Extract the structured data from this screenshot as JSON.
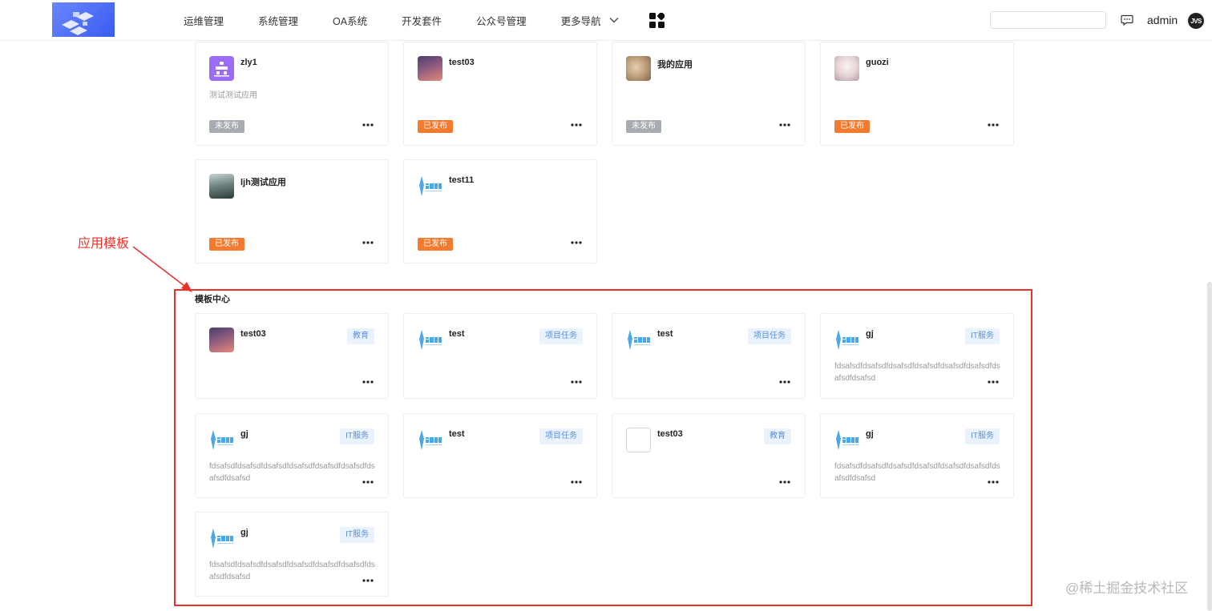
{
  "nav": {
    "items": [
      "运维管理",
      "系统管理",
      "OA系统",
      "开发套件",
      "公众号管理"
    ],
    "more_label": "更多导航"
  },
  "header": {
    "username": "admin",
    "avatar_text": "JVS",
    "search_value": ""
  },
  "apps": [
    {
      "name": "zly1",
      "desc": "测试测试应用",
      "status": "未发布",
      "icon": "app-icon"
    },
    {
      "name": "test03",
      "desc": "",
      "status": "已发布",
      "icon": "sunset-image"
    },
    {
      "name": "我的应用",
      "desc": "",
      "status": "未发布",
      "icon": "fur-image"
    },
    {
      "name": "guozi",
      "desc": "",
      "status": "已发布",
      "icon": "anime-image"
    },
    {
      "name": "ljh测试应用",
      "desc": "",
      "status": "已发布",
      "icon": "photo-image"
    },
    {
      "name": "test11",
      "desc": "",
      "status": "已发布",
      "icon": "platform-logo"
    }
  ],
  "templates_title": "模板中心",
  "templates": [
    {
      "name": "test03",
      "tag": "教育",
      "desc": "",
      "icon": "sunset-image"
    },
    {
      "name": "test",
      "tag": "项目任务",
      "desc": "",
      "icon": "platform-logo"
    },
    {
      "name": "test",
      "tag": "项目任务",
      "desc": "",
      "icon": "platform-logo"
    },
    {
      "name": "gj",
      "tag": "IT服务",
      "desc": "fdsafsdfdsafsdfdsafsdfdsafsdfdsafsdfdsafsdfdsafsdfdsafsd",
      "icon": "platform-logo"
    },
    {
      "name": "gj",
      "tag": "IT服务",
      "desc": "fdsafsdfdsafsdfdsafsdfdsafsdfdsafsdfdsafsdfdsafsdfdsafsd",
      "icon": "platform-logo"
    },
    {
      "name": "test",
      "tag": "项目任务",
      "desc": "",
      "icon": "platform-logo"
    },
    {
      "name": "test03",
      "tag": "教育",
      "desc": "",
      "icon": "blank-image"
    },
    {
      "name": "gj",
      "tag": "IT服务",
      "desc": "fdsafsdfdsafsdfdsafsdfdsafsdfdsafsdfdsafsdfdsafsdfdsafsd",
      "icon": "platform-logo"
    },
    {
      "name": "gj",
      "tag": "IT服务",
      "desc": "fdsafsdfdsafsdfdsafsdfdsafsdfdsafsdfdsafsdfdsafsdfdsafsd",
      "icon": "platform-logo"
    }
  ],
  "annotation": {
    "label": "应用模板",
    "color": "#e8312b"
  },
  "watermark": "@稀土掘金技术社区",
  "colors": {
    "published": "#f47a2d",
    "unpublished": "#a7abb2",
    "tag_text": "#5b8fd9",
    "tag_bg": "#eaf3fd"
  }
}
